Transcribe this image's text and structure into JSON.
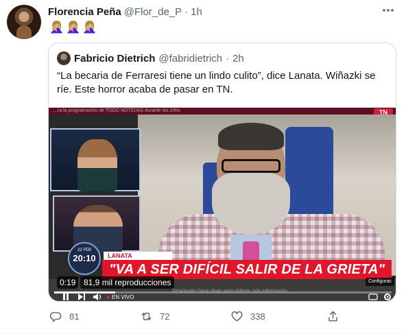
{
  "tweet": {
    "author_name": "Florencia Peña",
    "author_handle": "@Flor_de_P",
    "separator": "·",
    "time": "1h",
    "more_icon": "more-horizontal-icon",
    "text": "🤦🏼‍♀️🤦🏼‍♀️🤦🏼‍♀️"
  },
  "quoted_tweet": {
    "author_name": "Fabricio Dietrich",
    "author_handle": "@fabridietrich",
    "separator": "·",
    "time": "2h",
    "text": "“La becaria de Ferraresi tiene un lindo culito”, dice Lanata. Wiñazki se ríe. Este horror acaba de pasar en TN."
  },
  "video": {
    "ticker_top": "…ra la programación de TODO NOTICIAS durante los 24hs",
    "channel_logo": "TN",
    "clock_date": "22 FEB",
    "clock_time": "20:10",
    "lower_third_name": "LANATA",
    "headline": "\"VA A SER DIFÍCIL SALIR DE LA GRIETA\"",
    "ticker_hint": "Desplazate hacia abajo para obtener más información",
    "elapsed": "0:19",
    "views": "81,9 mil reproducciones",
    "settings_label": "Configurac",
    "live_label": "EN VIVO",
    "progress_fraction": 0.18
  },
  "actions": {
    "reply_count": "81",
    "retweet_count": "72",
    "like_count": "338",
    "reply_icon": "reply-icon",
    "retweet_icon": "retweet-icon",
    "like_icon": "heart-icon",
    "share_icon": "share-icon"
  },
  "colors": {
    "text_primary": "#0f1419",
    "text_secondary": "#536471",
    "border": "#cfd9de",
    "tn_red": "#e0162b"
  }
}
